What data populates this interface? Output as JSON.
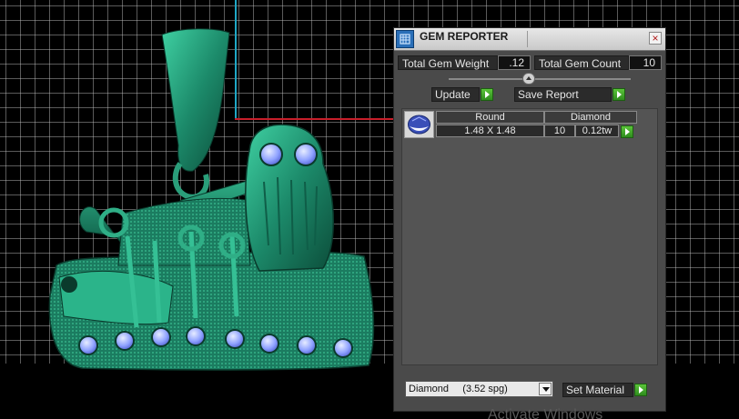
{
  "panel": {
    "title": "GEM REPORTER",
    "close_label": "×",
    "total_gem_weight_label": "Total Gem Weight",
    "total_gem_weight_value": ".12",
    "total_gem_count_label": "Total Gem Count",
    "total_gem_count_value": "10",
    "update_label": "Update",
    "save_report_label": "Save Report",
    "gem_table": {
      "headers": [
        "Round",
        "Diamond"
      ],
      "row": {
        "size": "1.48 X 1.48",
        "count": "10",
        "weight": "0.12tw"
      }
    },
    "material_select_value": "Diamond     (3.52 spg)",
    "set_material_label": "Set Material"
  },
  "watermark": "Activate Windows",
  "colors": {
    "panel_bg": "#4a4a4a",
    "viewport_bg": "#000000",
    "model_green": "#1e8c6e",
    "gem_blue": "#8fa2ff",
    "go_green": "#3fa82a",
    "axis_x": "#c81e2a",
    "axis_y": "#1fa7c5"
  },
  "icons": [
    "gem-reporter-app-icon",
    "close-icon",
    "slider-thumb-icon",
    "play-arrow-icon",
    "round-gem-icon",
    "dropdown-arrow-icon"
  ]
}
